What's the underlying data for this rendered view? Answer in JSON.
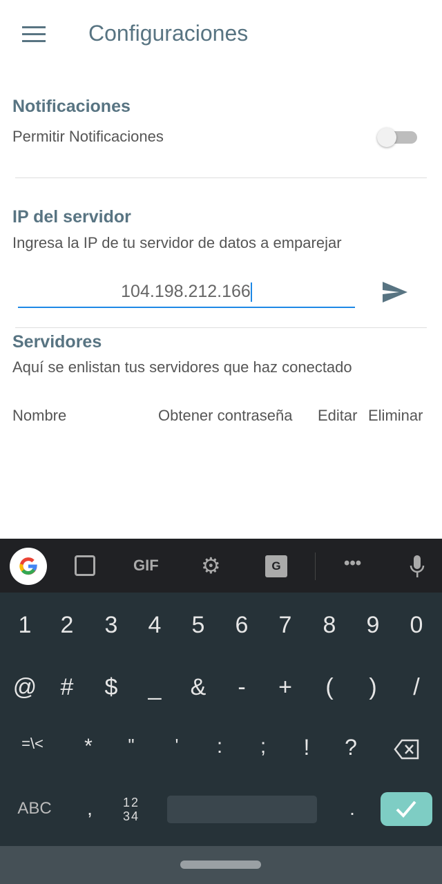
{
  "header": {
    "title": "Configuraciones",
    "menu_icon": "hamburger-menu-icon"
  },
  "notifications": {
    "heading": "Notificaciones",
    "label": "Permitir Notificaciones",
    "enabled": false
  },
  "server_ip": {
    "heading": "IP del servidor",
    "description": "Ingresa la IP de tu servidor de datos a emparejar",
    "value": "104.198.212.166",
    "send_icon": "send-icon"
  },
  "servers": {
    "heading": "Servidores",
    "description": "Aquí se enlistan tus servidores que haz conectado",
    "columns": [
      "Nombre",
      "Obtener contraseña",
      "Editar",
      "Eliminar"
    ]
  },
  "keyboard": {
    "toolbar": {
      "gif": "GIF",
      "icons": [
        "google-icon",
        "sticker-icon",
        "gif-icon",
        "gear-icon",
        "translate-icon",
        "more-icon",
        "microphone-icon"
      ]
    },
    "row1": [
      "1",
      "2",
      "3",
      "4",
      "5",
      "6",
      "7",
      "8",
      "9",
      "0"
    ],
    "row2": [
      "@",
      "#",
      "$",
      "_",
      "&",
      "-",
      "+",
      "(",
      ")",
      "/"
    ],
    "row3": [
      "=\\<",
      "*",
      "\"",
      "'",
      ":",
      ";",
      "!",
      "?"
    ],
    "row4": {
      "abc": "ABC",
      "comma": ",",
      "num_top": "12",
      "num_bottom": "34",
      "period": "."
    },
    "colors": {
      "toolbar": "#202124",
      "keys": "#263238",
      "enter": "#7ecdc4"
    }
  }
}
